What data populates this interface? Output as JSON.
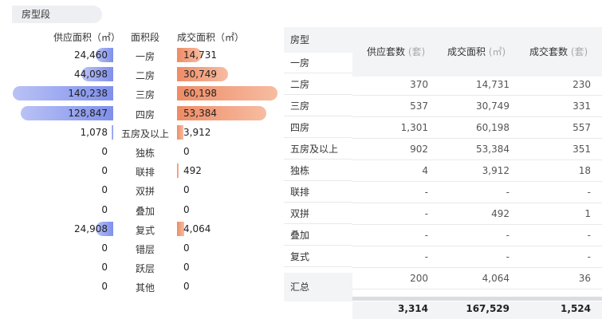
{
  "section_tag": "房型段",
  "chart": {
    "header_supply": "供应面积（㎡）",
    "header_segment": "面积段",
    "header_deal": "成交面积（㎡）"
  },
  "chart_data": {
    "type": "bar",
    "categories": [
      "一房",
      "二房",
      "三房",
      "四房",
      "五房及以上",
      "独栋",
      "联排",
      "双拼",
      "叠加",
      "复式",
      "错层",
      "跃层",
      "其他"
    ],
    "series": [
      {
        "name": "供应面积（㎡）",
        "values": [
          24460,
          44098,
          140238,
          128847,
          1078,
          0,
          0,
          0,
          0,
          24908,
          0,
          0,
          0
        ]
      },
      {
        "name": "成交面积（㎡）",
        "values": [
          14731,
          30749,
          60198,
          53384,
          3912,
          0,
          492,
          0,
          0,
          4064,
          0,
          0,
          0
        ]
      }
    ],
    "labels_supply": [
      "24,460",
      "44,098",
      "140,238",
      "128,847",
      "1,078",
      "0",
      "0",
      "0",
      "0",
      "24,908",
      "0",
      "0",
      "0"
    ],
    "labels_deal": [
      "14,731",
      "30,749",
      "60,198",
      "53,384",
      "3,912",
      "0",
      "492",
      "0",
      "0",
      "4,064",
      "0",
      "0",
      "0"
    ],
    "colors": {
      "supply": "#8796ee",
      "deal": "#f2a07f"
    }
  },
  "table": {
    "col_type": "房型",
    "col_supply_units": "供应套数",
    "col_deal_area": "成交面积",
    "col_deal_units": "成交套数",
    "unit_tao": "(套)",
    "unit_sqm": "(㎡)",
    "type_rows": [
      "一房",
      "二房",
      "三房",
      "四房",
      "五房及以上",
      "独栋",
      "联排",
      "双拼",
      "叠加",
      "复式"
    ],
    "total_label": "汇总",
    "data_rows": [
      [
        "370",
        "14,731",
        "230"
      ],
      [
        "537",
        "30,749",
        "331"
      ],
      [
        "1,301",
        "60,198",
        "557"
      ],
      [
        "902",
        "53,384",
        "351"
      ],
      [
        "4",
        "3,912",
        "18"
      ],
      [
        "-",
        "-",
        "-"
      ],
      [
        "-",
        "492",
        "1"
      ],
      [
        "-",
        "-",
        "-"
      ],
      [
        "-",
        "-",
        "-"
      ],
      [
        "200",
        "4,064",
        "36"
      ]
    ],
    "totals": [
      "3,314",
      "167,529",
      "1,524"
    ]
  }
}
